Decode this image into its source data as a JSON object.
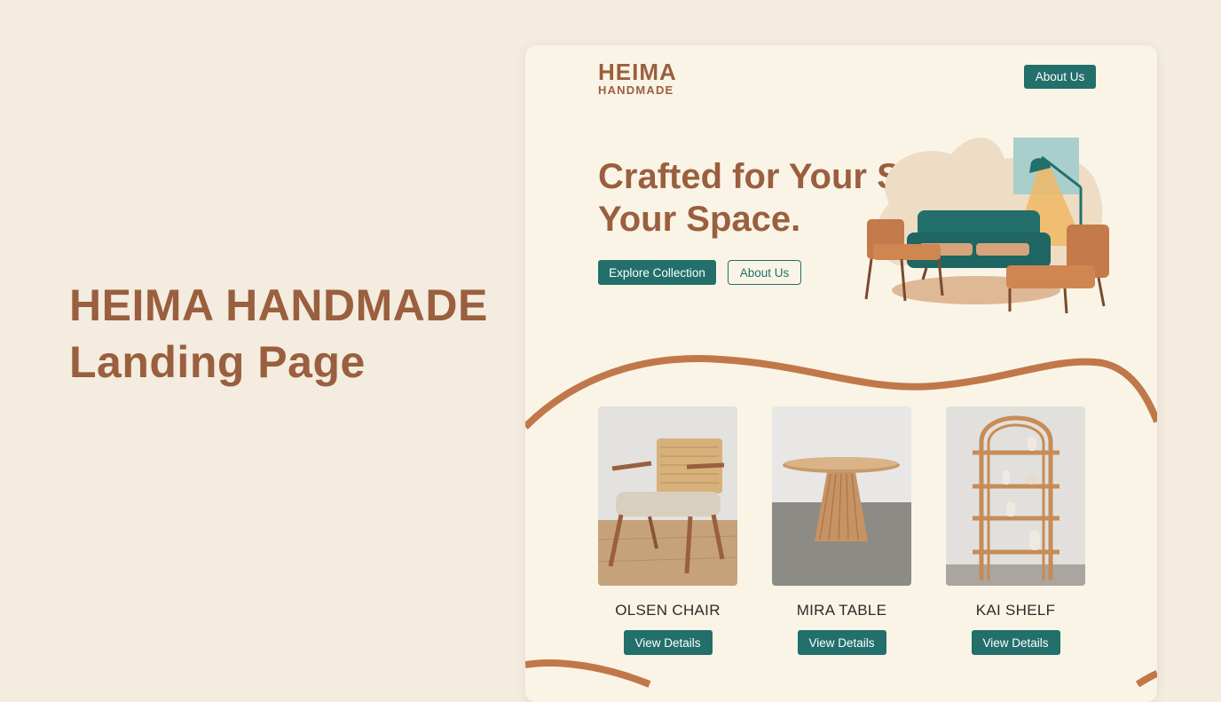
{
  "slide_title": {
    "line1": "HEIMA HANDMADE",
    "line2": "Landing Page"
  },
  "header": {
    "logo_main": "HEIMA",
    "logo_sub": "HANDMADE",
    "about_label": "About Us"
  },
  "hero": {
    "headline_line1": "Crafted for Your Story.",
    "headline_line2": "Your Space.",
    "explore_label": "Explore Collection",
    "about_label": "About Us"
  },
  "products": [
    {
      "name": "OLSEN CHAIR",
      "button": "View Details"
    },
    {
      "name": "MIRA TABLE",
      "button": "View Details"
    },
    {
      "name": "KAI SHELF",
      "button": "View Details"
    }
  ],
  "colors": {
    "brand_brown": "#9a5f3e",
    "accent_teal": "#226f6b",
    "page_bg": "#f3ecdf",
    "card_bg": "#faf4e7"
  },
  "icons": {
    "hero_illustration": "living-room-illustration",
    "product_images": [
      "chair-photo",
      "table-photo",
      "shelf-photo"
    ]
  }
}
